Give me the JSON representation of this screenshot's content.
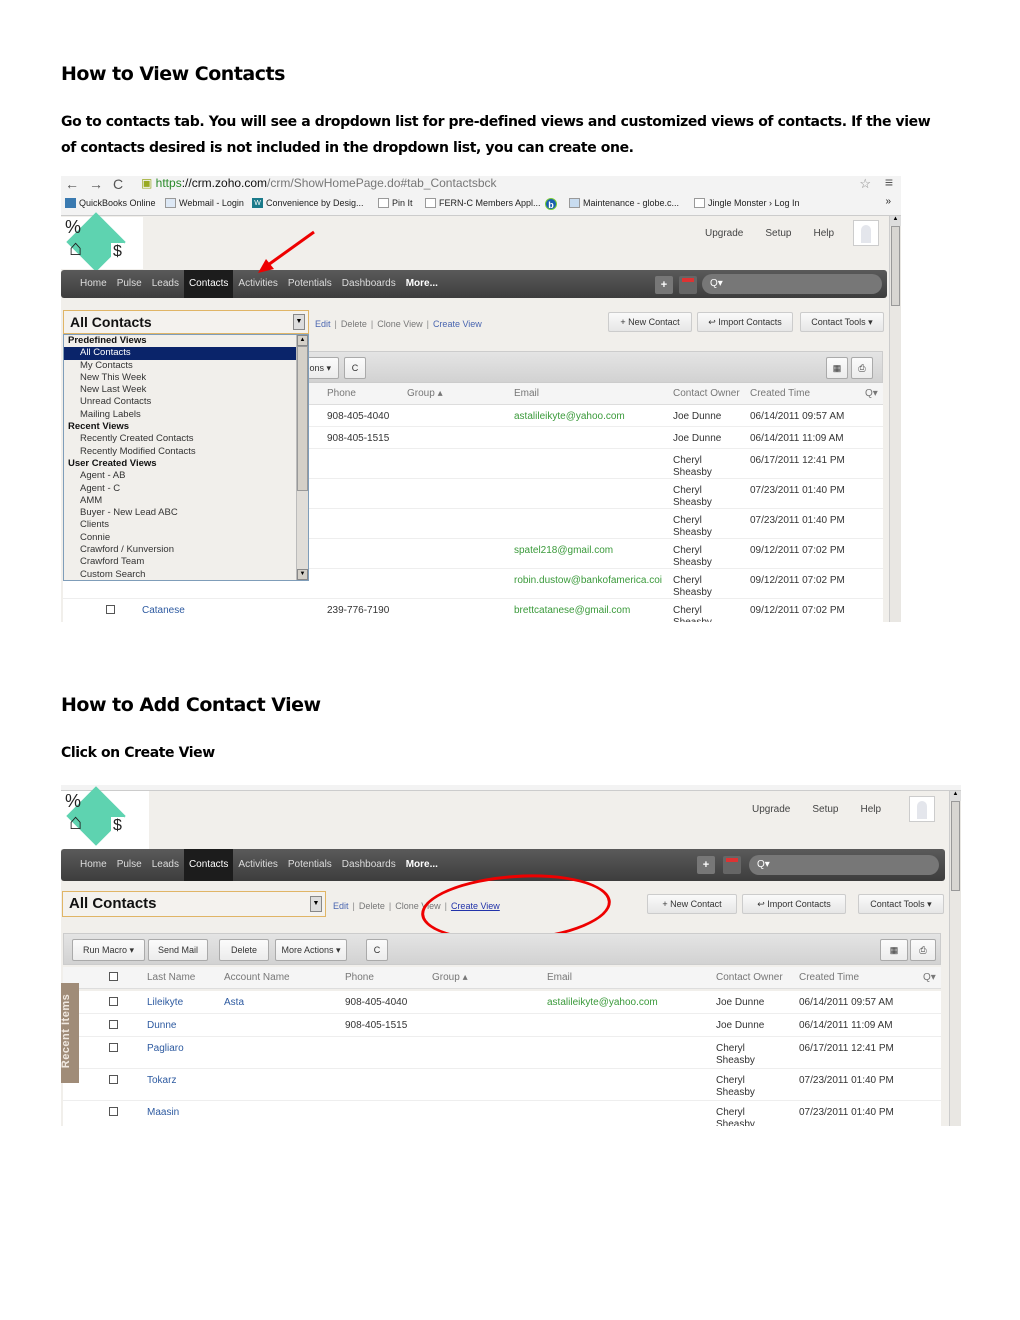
{
  "section1": {
    "heading": "How to View Contacts",
    "paragraph_line1": "Go to contacts tab.  You will see a dropdown list for pre-defined views and customized views of contacts.  If the view",
    "paragraph_line2": "of contacts desired is not included in the dropdown list, you can create one."
  },
  "section2": {
    "heading": "How to Add Contact View",
    "instruction": "Click on Create View"
  },
  "browser": {
    "url_scheme": "https",
    "url_host": "://crm.zoho.com",
    "url_path": "/crm/ShowHomePage.do#tab_Contactsbck",
    "bookmarks": [
      {
        "label": "QuickBooks Online",
        "icon": "quickbooks-icon"
      },
      {
        "label": "Webmail - Login",
        "icon": "mail-icon"
      },
      {
        "label": "Convenience by Desig...",
        "icon": "wd-icon"
      },
      {
        "label": "Pin It",
        "icon": "page-icon"
      },
      {
        "label": "FERN-C Members Appl...",
        "icon": "page-icon"
      },
      {
        "label": "",
        "icon": "b-logo-icon"
      },
      {
        "label": "Maintenance - globe.c...",
        "icon": "site-icon"
      },
      {
        "label": "Jingle Monster › Log In",
        "icon": "page-icon"
      }
    ],
    "overflow": "»"
  },
  "app": {
    "top_links": [
      "Upgrade",
      "Setup",
      "Help"
    ],
    "tabs": [
      "Home",
      "Pulse",
      "Leads",
      "Contacts",
      "Activities",
      "Potentials",
      "Dashboards",
      "More..."
    ],
    "active_tab": "Contacts",
    "add_button": "+",
    "search_placeholder": "Q▾",
    "view_select": "All Contacts",
    "view_links": {
      "edit": "Edit",
      "delete": "Delete",
      "clone": "Clone View",
      "create": "Create View"
    },
    "buttons": {
      "new_contact": "+  New Contact",
      "import_contacts": "Import Contacts",
      "contact_tools": "Contact Tools ▾"
    },
    "toolbar": {
      "run_macro": "Run Macro ▾",
      "send_mail": "Send Mail",
      "delete": "Delete",
      "more_actions": "More Actions ▾",
      "more_actions_partial": "ons ▾",
      "refresh": "C"
    },
    "columns": [
      "Last Name",
      "Account Name",
      "Phone",
      "Group ▴",
      "Email",
      "Contact Owner",
      "Created Time"
    ],
    "recent_items": "Recent Items"
  },
  "dropdown": {
    "groups": [
      {
        "label": "Predefined Views",
        "items": [
          "All Contacts",
          "My Contacts",
          "New This Week",
          "New Last Week",
          "Unread Contacts",
          "Mailing Labels"
        ]
      },
      {
        "label": "Recent Views",
        "items": [
          "Recently Created Contacts",
          "Recently Modified Contacts"
        ]
      },
      {
        "label": "User Created Views",
        "items": [
          "Agent - AB",
          "Agent - C",
          "AMM",
          "Buyer - New Lead ABC",
          "Clients",
          "Connie",
          "Crawford / Kunversion",
          "Crawford Team",
          "Custom Search"
        ]
      }
    ],
    "selected": "All Contacts"
  },
  "contacts": [
    {
      "last_name": "Lileikyte",
      "account": "Asta",
      "phone": "908-405-4040",
      "email": "astalileikyte@yahoo.com",
      "owner": "Joe Dunne",
      "created": "06/14/2011 09:57 AM"
    },
    {
      "last_name": "Dunne",
      "account": "",
      "phone": "908-405-1515",
      "email": "",
      "owner": "Joe Dunne",
      "created": "06/14/2011 11:09 AM"
    },
    {
      "last_name": "Pagliaro",
      "account": "",
      "phone": "",
      "email": "",
      "owner": "Cheryl Sheasby",
      "created": "06/17/2011 12:41 PM"
    },
    {
      "last_name": "Tokarz",
      "account": "",
      "phone": "",
      "email": "",
      "owner": "Cheryl Sheasby",
      "created": "07/23/2011 01:40 PM"
    },
    {
      "last_name": "Maasin",
      "account": "",
      "phone": "",
      "email": "",
      "owner": "Cheryl Sheasby",
      "created": "07/23/2011 01:40 PM"
    },
    {
      "last_name": "",
      "account": "",
      "phone": "",
      "email": "spatel218@gmail.com",
      "owner": "Cheryl Sheasby",
      "created": "09/12/2011 07:02 PM"
    },
    {
      "last_name": "",
      "account": "",
      "phone": "",
      "email": "robin.dustow@bankofamerica.coi",
      "owner": "Cheryl Sheasby",
      "created": "09/12/2011 07:02 PM"
    },
    {
      "last_name": "Catanese",
      "account": "",
      "phone": "239-776-7190",
      "email": "brettcatanese@gmail.com",
      "owner": "Cheryl Sheasby",
      "created": "09/12/2011 07:02 PM"
    }
  ],
  "colors": {
    "annotation_red": "#e00000",
    "nav_dark": "#3d3d3d",
    "selection_blue": "#0a246a",
    "email_green": "#3a9a3a",
    "link_blue": "#2d5aa0"
  }
}
